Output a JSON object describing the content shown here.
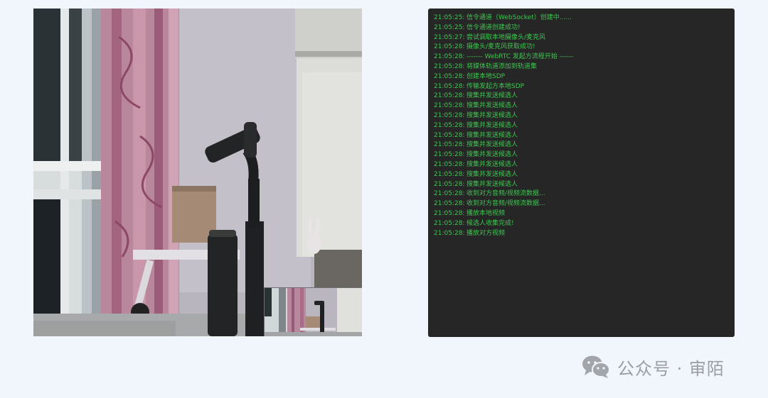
{
  "log": {
    "lines": [
      {
        "time": "21:05:25:",
        "msg": "信令通道（WebSocket）创建中......"
      },
      {
        "time": "21:05:25:",
        "msg": "信令通道创建成功!"
      },
      {
        "time": "21:05:27:",
        "msg": "尝试调取本地摄像头/麦克风"
      },
      {
        "time": "21:05:28:",
        "msg": "摄像头/麦克风获取成功!"
      },
      {
        "time": "21:05:28:",
        "msg": "------- WebRTC 发起方流程开始 ------"
      },
      {
        "time": "21:05:28:",
        "msg": "将媒体轨道添加到轨道集"
      },
      {
        "time": "21:05:28:",
        "msg": "创建本地SDP"
      },
      {
        "time": "21:05:28:",
        "msg": "传输发起方本地SDP"
      },
      {
        "time": "21:05:28:",
        "msg": "搜集并发送候选人"
      },
      {
        "time": "21:05:28:",
        "msg": "搜集并发送候选人"
      },
      {
        "time": "21:05:28:",
        "msg": "搜集并发送候选人"
      },
      {
        "time": "21:05:28:",
        "msg": "搜集并发送候选人"
      },
      {
        "time": "21:05:28:",
        "msg": "搜集并发送候选人"
      },
      {
        "time": "21:05:28:",
        "msg": "搜集并发送候选人"
      },
      {
        "time": "21:05:28:",
        "msg": "搜集并发送候选人"
      },
      {
        "time": "21:05:28:",
        "msg": "搜集并发送候选人"
      },
      {
        "time": "21:05:28:",
        "msg": "搜集并发送候选人"
      },
      {
        "time": "21:05:28:",
        "msg": "搜集并发送候选人"
      },
      {
        "time": "21:05:28:",
        "msg": "收到对方音频/视频流数据..."
      },
      {
        "time": "21:05:28:",
        "msg": "收到对方音频/视频流数据..."
      },
      {
        "time": "21:05:28:",
        "msg": "播放本地视频"
      },
      {
        "time": "21:05:28:",
        "msg": "候选人收集完成!"
      },
      {
        "time": "21:05:28:",
        "msg": "播放对方视频"
      }
    ]
  },
  "watermark": {
    "text": "公众号 · 审陌",
    "icon": "wechat-icon"
  },
  "colors": {
    "page_bg": "#f1f6fd",
    "log_bg": "#262626",
    "log_text": "#3cc74f",
    "watermark": "#9a9ea3"
  }
}
